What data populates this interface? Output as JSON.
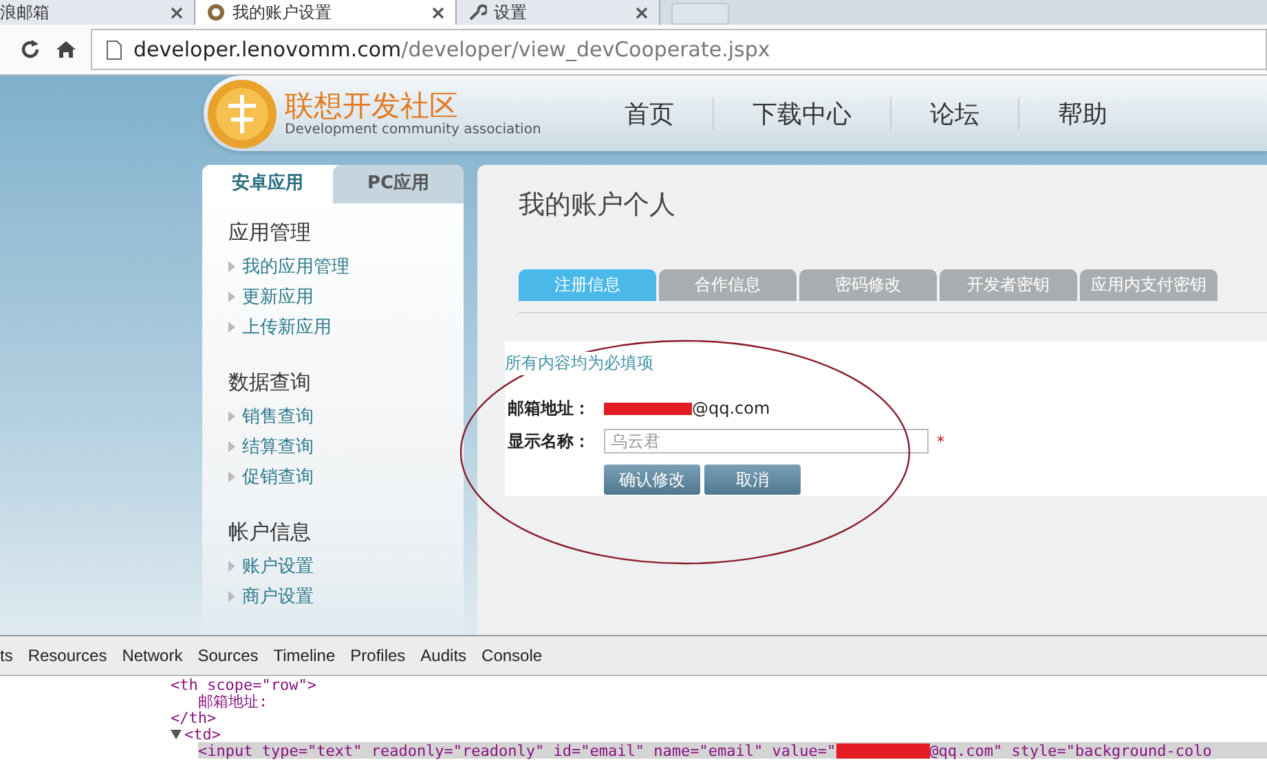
{
  "browser_tabs": [
    {
      "label": "浪邮箱",
      "selected": false
    },
    {
      "label": "我的账户设置",
      "selected": true
    },
    {
      "label": "设置",
      "selected": false
    }
  ],
  "address_bar": {
    "host": "developer.lenovomm.com",
    "path": "/developer/view_devCooperate.jspx"
  },
  "site_header": {
    "logo_title": "联想开发社区",
    "logo_subtitle": "Development community association",
    "nav": [
      "首页",
      "下载中心",
      "论坛",
      "帮助"
    ]
  },
  "sidebar": {
    "tabs": [
      {
        "label": "安卓应用",
        "selected": true
      },
      {
        "label": "PC应用",
        "selected": false
      }
    ],
    "groups": [
      {
        "title": "应用管理",
        "items": [
          "我的应用管理",
          "更新应用",
          "上传新应用"
        ]
      },
      {
        "title": "数据查询",
        "items": [
          "销售查询",
          "结算查询",
          "促销查询"
        ]
      },
      {
        "title": "帐户信息",
        "items": [
          "账户设置",
          "商户设置"
        ]
      }
    ]
  },
  "main": {
    "title": "我的账户个人",
    "tabs": [
      {
        "label": "注册信息",
        "selected": true
      },
      {
        "label": "合作信息",
        "selected": false
      },
      {
        "label": "密码修改",
        "selected": false
      },
      {
        "label": "开发者密钥",
        "selected": false
      },
      {
        "label": "应用内支付密钥",
        "selected": false
      }
    ],
    "required_note": "所有内容均为必填项",
    "email": {
      "label": "邮箱地址：",
      "value": "@qq.com"
    },
    "display_name": {
      "label": "显示名称：",
      "placeholder": "乌云君",
      "required_mark": "*"
    },
    "buttons": [
      "确认修改",
      "取消"
    ]
  },
  "devtools": {
    "tabs": [
      "ts",
      "Resources",
      "Network",
      "Sources",
      "Timeline",
      "Profiles",
      "Audits",
      "Console"
    ],
    "code": [
      {
        "text": "<th scope=\"row\">",
        "children": [
          {
            "text": "邮箱地址:"
          }
        ]
      },
      {
        "text": "</th>"
      },
      {
        "text": "<td>",
        "expanded": true,
        "children": [
          {
            "text": "<input type=\"text\" readonly=\"readonly\" id=\"email\" name=\"email\" value=\"",
            "after": "@qq.com\" style=\"background-colo",
            "redacted": true,
            "selected": true
          }
        ]
      }
    ]
  }
}
